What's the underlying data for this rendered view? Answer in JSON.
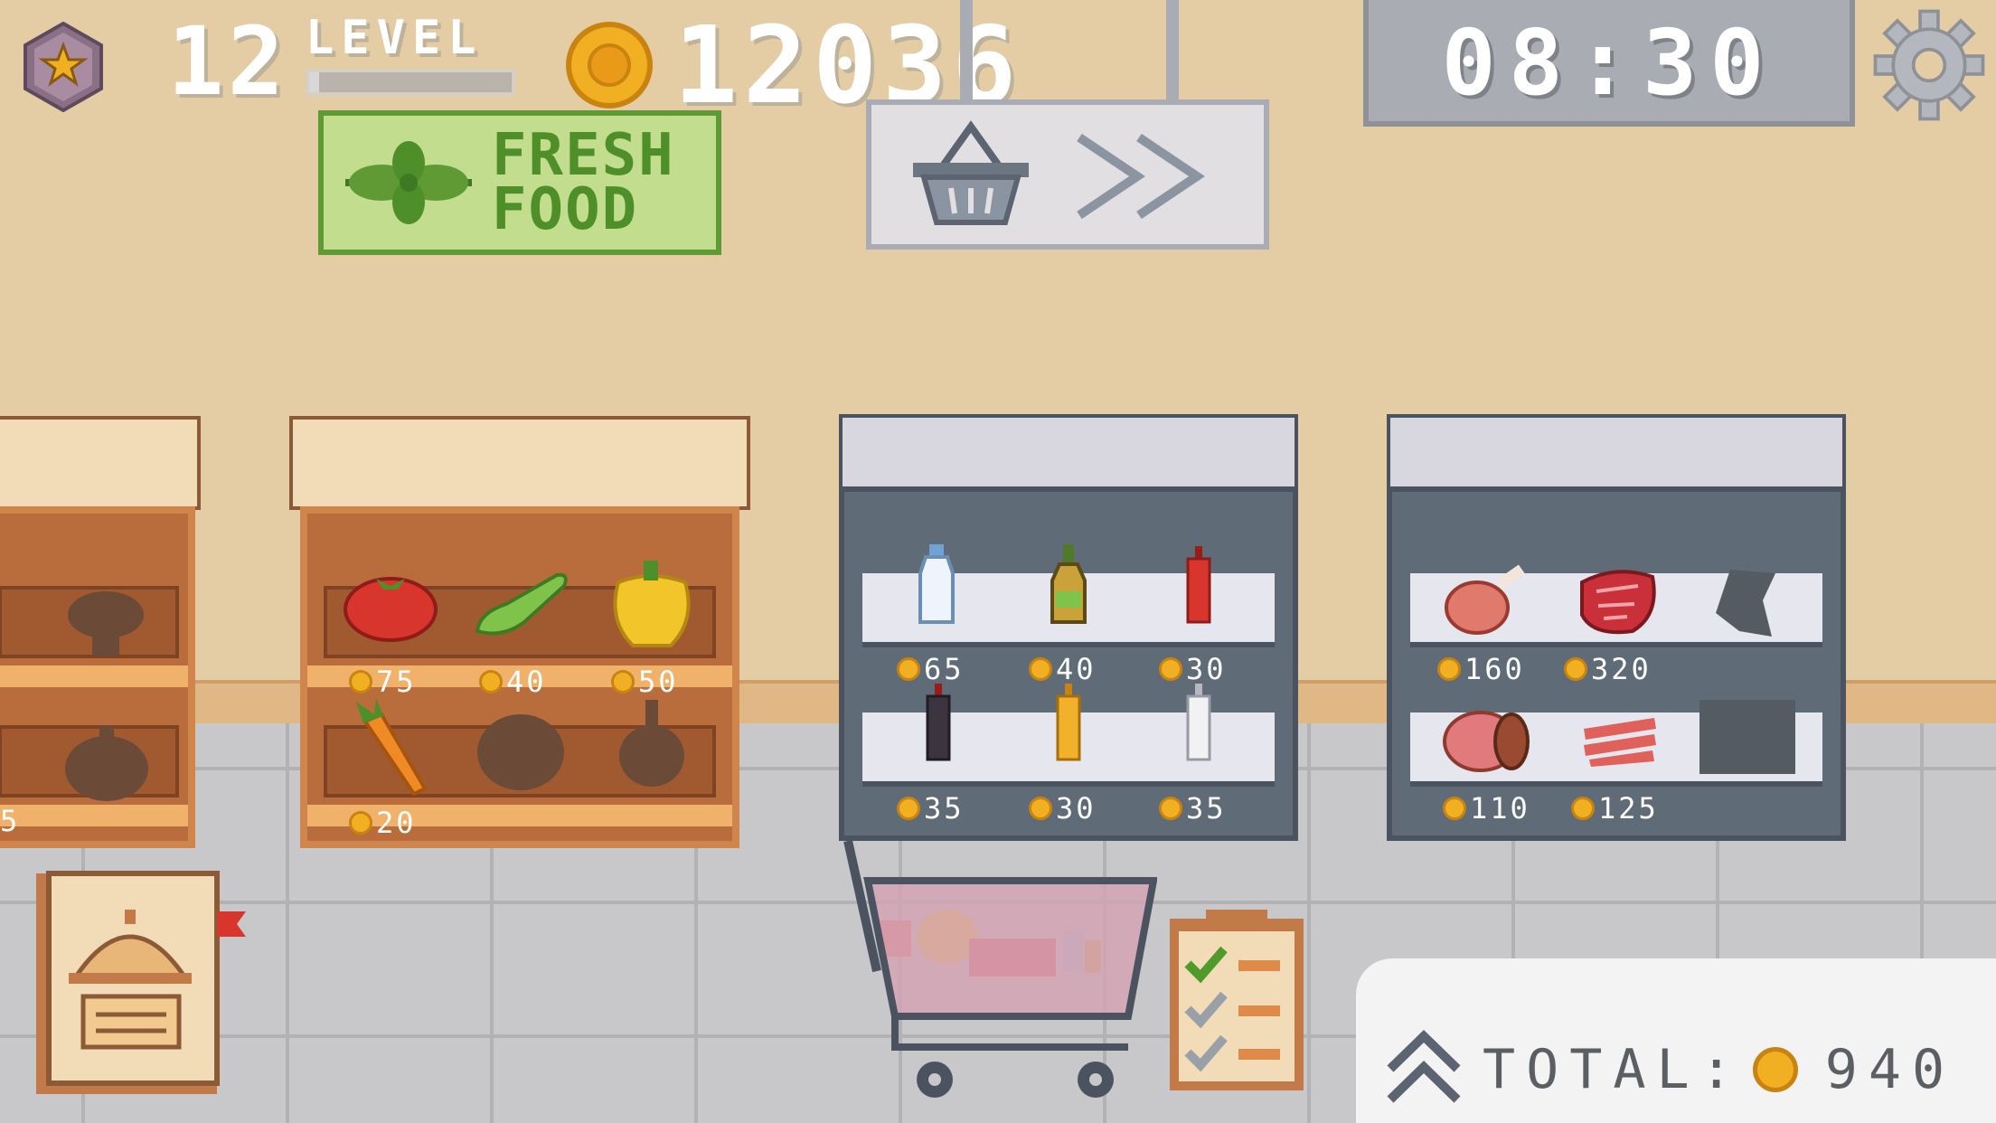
{
  "hud": {
    "level_number": "12",
    "level_label": "LEVEL",
    "level_progress": 0.05,
    "coins": "12036",
    "clock": "08:30"
  },
  "signs": {
    "fresh_line1": "FRESH",
    "fresh_line2": "FOOD"
  },
  "shelves": {
    "left_partial_price": "5",
    "vegetables": {
      "top_prices": [
        "75",
        "40",
        "50"
      ],
      "bottom_prices": [
        "20"
      ]
    }
  },
  "fridges": {
    "drinks": {
      "top_prices": [
        "65",
        "40",
        "30"
      ],
      "bottom_prices": [
        "35",
        "30",
        "35"
      ]
    },
    "meat": {
      "top_prices": [
        "160",
        "320"
      ],
      "bottom_prices": [
        "110",
        "125"
      ]
    }
  },
  "total": {
    "label": "TOTAL:",
    "value": "940"
  },
  "colors": {
    "wall": "#e4cda5",
    "floor": "#c8c7c9",
    "coin": "#f0b021",
    "sign_green": "#c2dd8e",
    "fridge": "#5f6b77"
  },
  "icons": [
    "star-badge-icon",
    "coin-icon",
    "gear-icon",
    "herb-icon",
    "basket-icon",
    "fast-forward-icon",
    "recipe-book-icon",
    "cloche-icon",
    "shopping-cart-icon",
    "checklist-icon",
    "chevron-up-icon"
  ]
}
